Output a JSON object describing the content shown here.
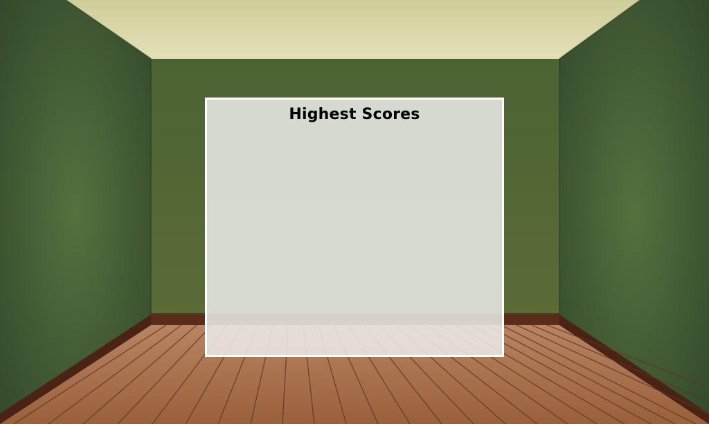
{
  "panel": {
    "title": "Highest Scores",
    "scores": []
  },
  "colors": {
    "wall": "#46603a",
    "ceiling": "#d8d6a6",
    "floor": "#a8704a",
    "baseboard": "#5a2c1a",
    "panel_border": "#ffffff"
  }
}
